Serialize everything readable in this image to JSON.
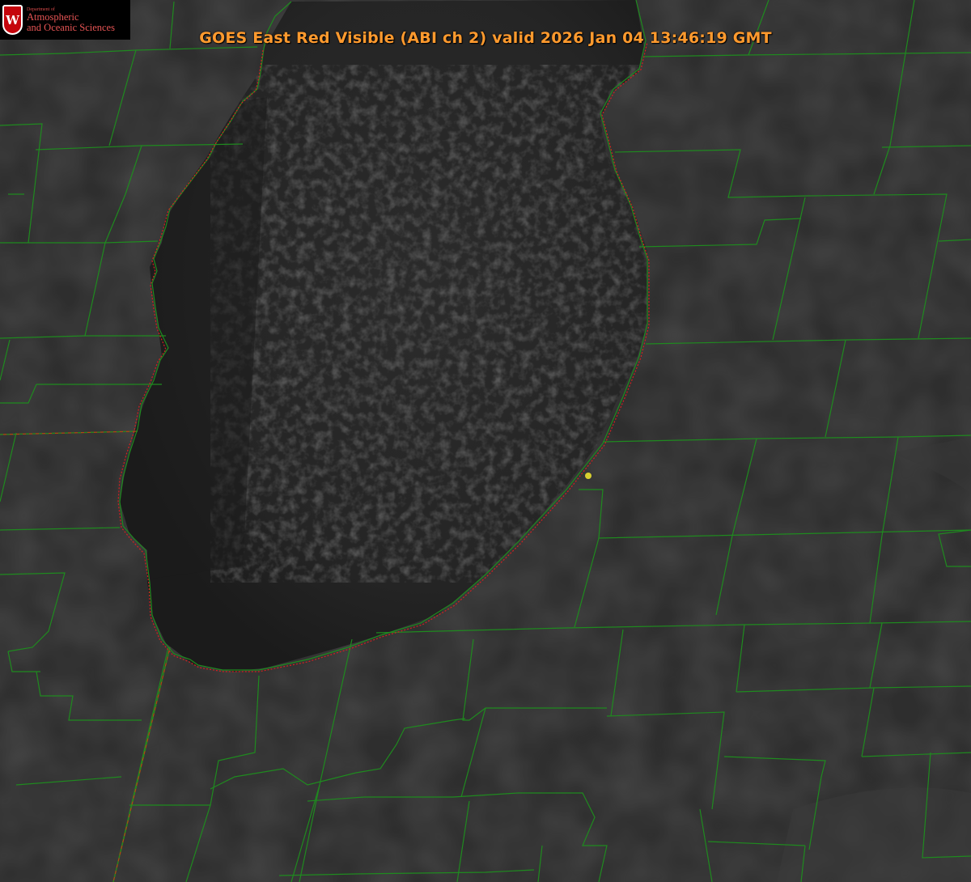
{
  "title": "GOES East Red Visible (ABI ch 2) valid 2026 Jan 04 13:46:19 GMT",
  "logo": {
    "crest_letter": "W",
    "department": "Department of",
    "line1": "Atmospheric",
    "line2": "and Oceanic Sciences"
  },
  "colors": {
    "land": "#2e2e2e",
    "lake": "#1e1e1e",
    "county_lines": "#1f8a1f",
    "shoreline_dotted": "#d42020",
    "state_line": "#8a5a10",
    "title": "#ff9a2e",
    "marker": "#d8d030"
  },
  "legend_icons": [
    "university-crest-icon"
  ]
}
